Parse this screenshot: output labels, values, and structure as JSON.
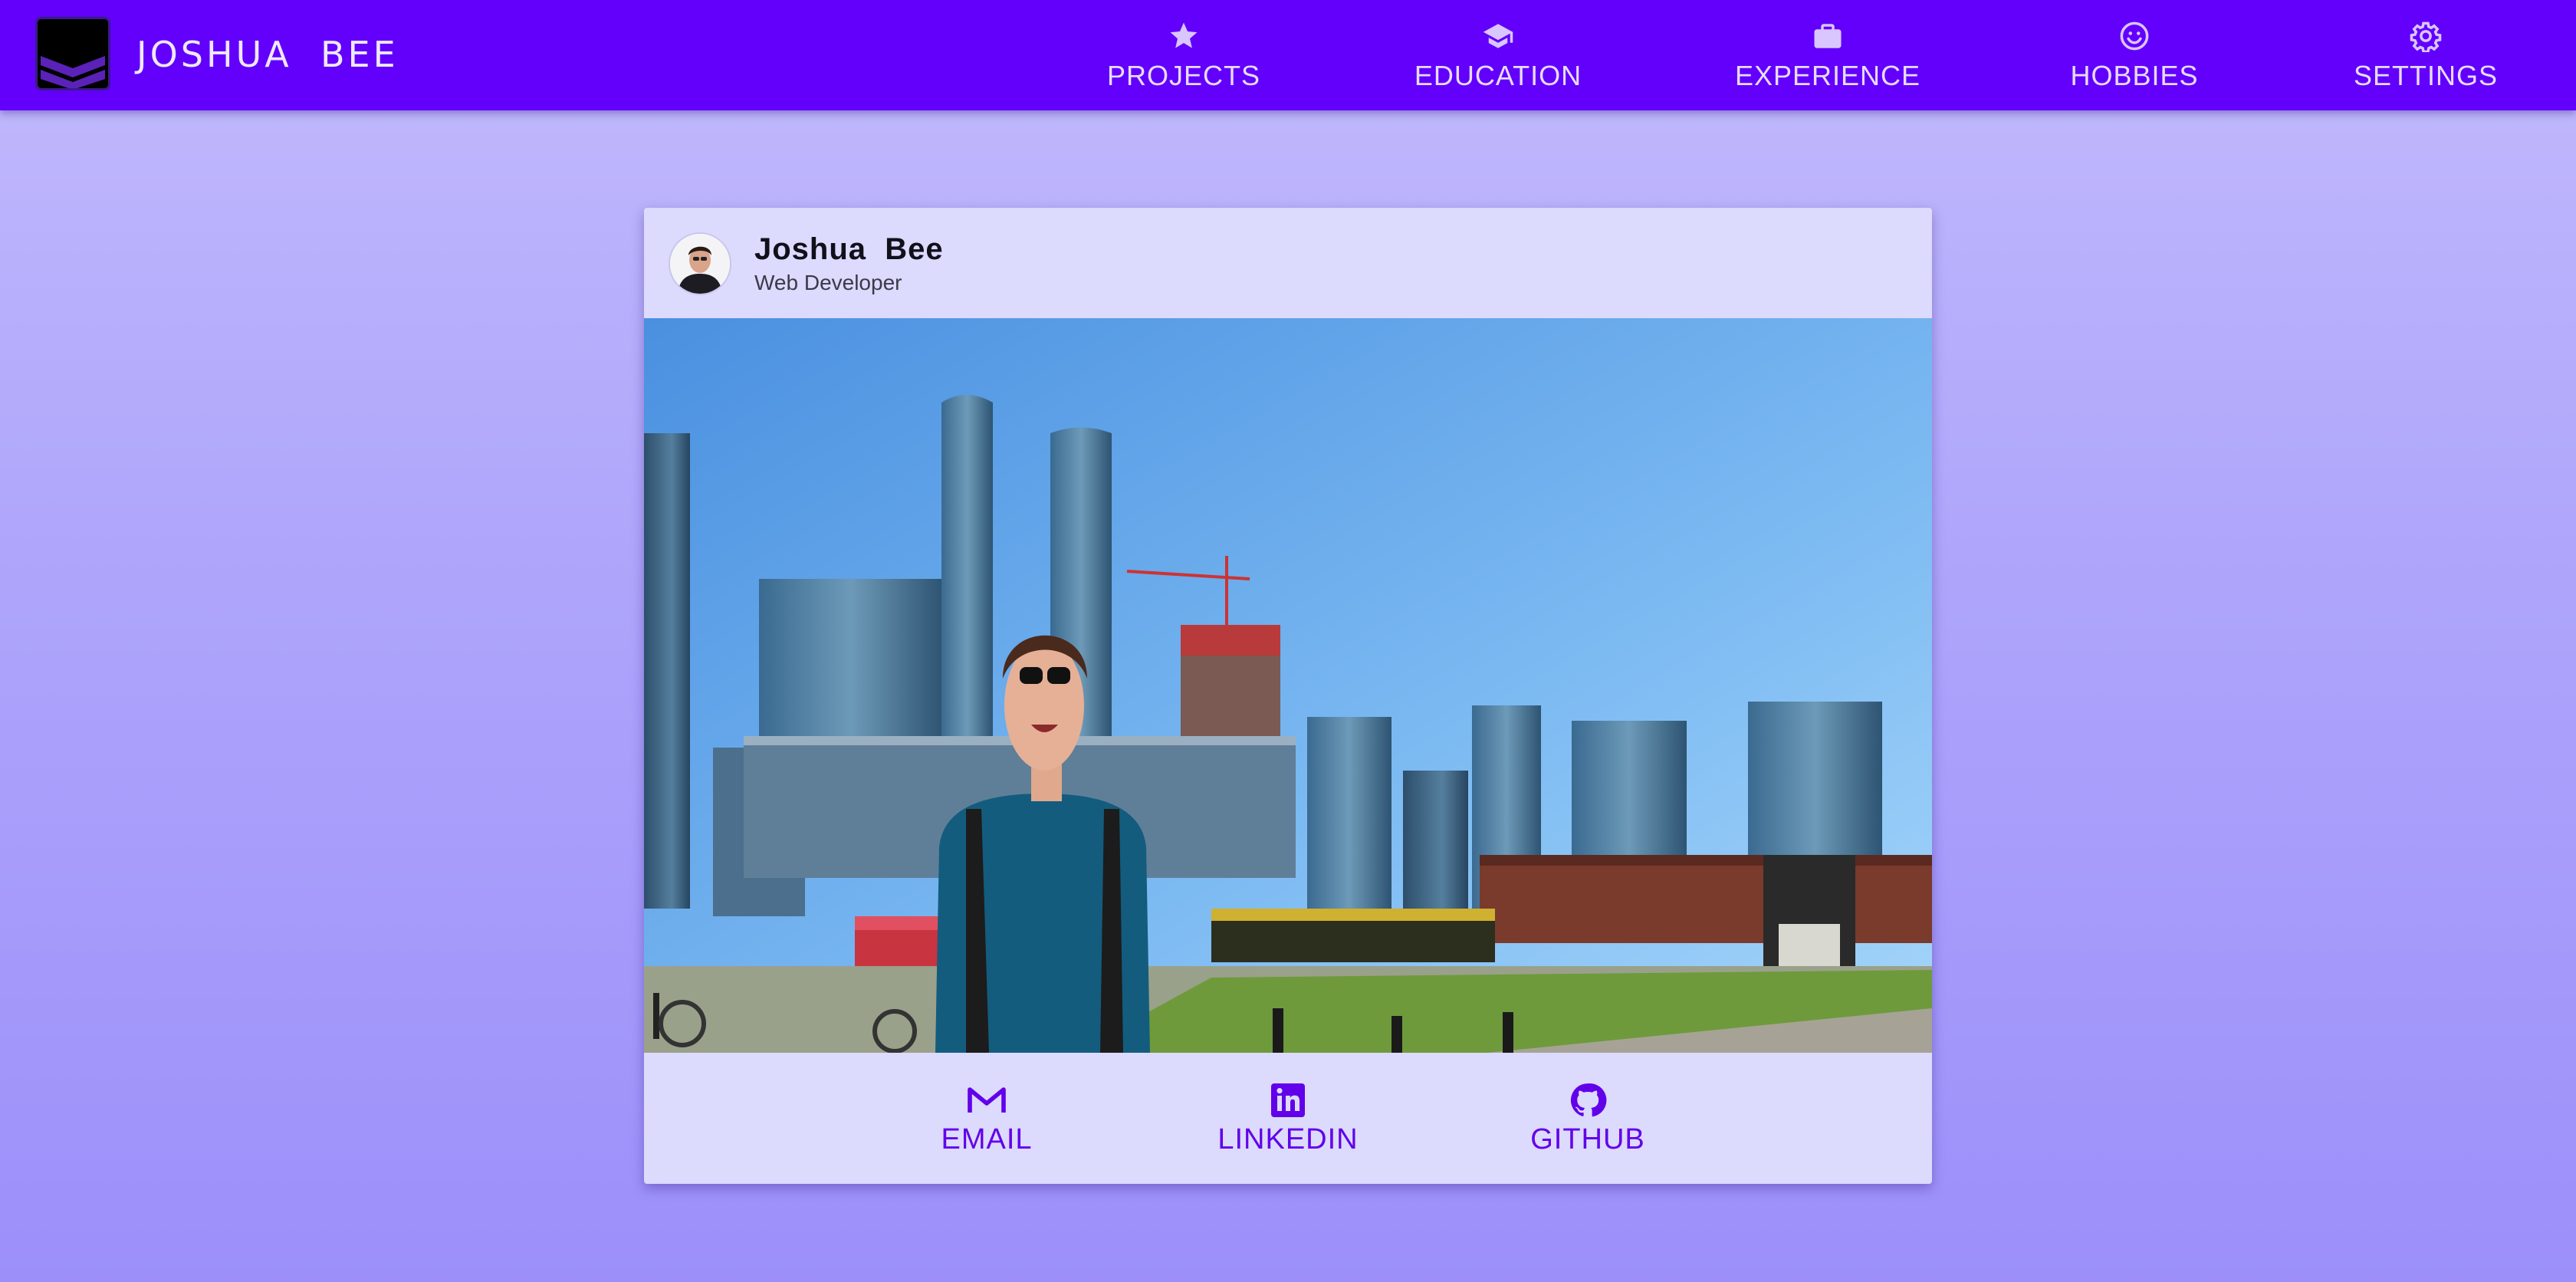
{
  "app": {
    "title": "JOSHUA  BEE"
  },
  "nav": [
    {
      "label": "PROJECTS",
      "icon": "star-icon"
    },
    {
      "label": "EDUCATION",
      "icon": "graduation-cap-icon"
    },
    {
      "label": "EXPERIENCE",
      "icon": "briefcase-icon"
    },
    {
      "label": "HOBBIES",
      "icon": "smiley-icon"
    },
    {
      "label": "SETTINGS",
      "icon": "gear-icon"
    }
  ],
  "profile": {
    "name": "Joshua  Bee",
    "title": "Web Developer",
    "photo": "city-skyline-photo"
  },
  "actions": [
    {
      "label": "EMAIL",
      "icon": "gmail-icon"
    },
    {
      "label": "LINKEDIN",
      "icon": "linkedin-icon"
    },
    {
      "label": "GITHUB",
      "icon": "github-icon"
    }
  ],
  "colors": {
    "appbar": "#6200fb",
    "accent": "#6200ea",
    "card": "#dcdafd",
    "nav_text": "#e8dbff"
  }
}
